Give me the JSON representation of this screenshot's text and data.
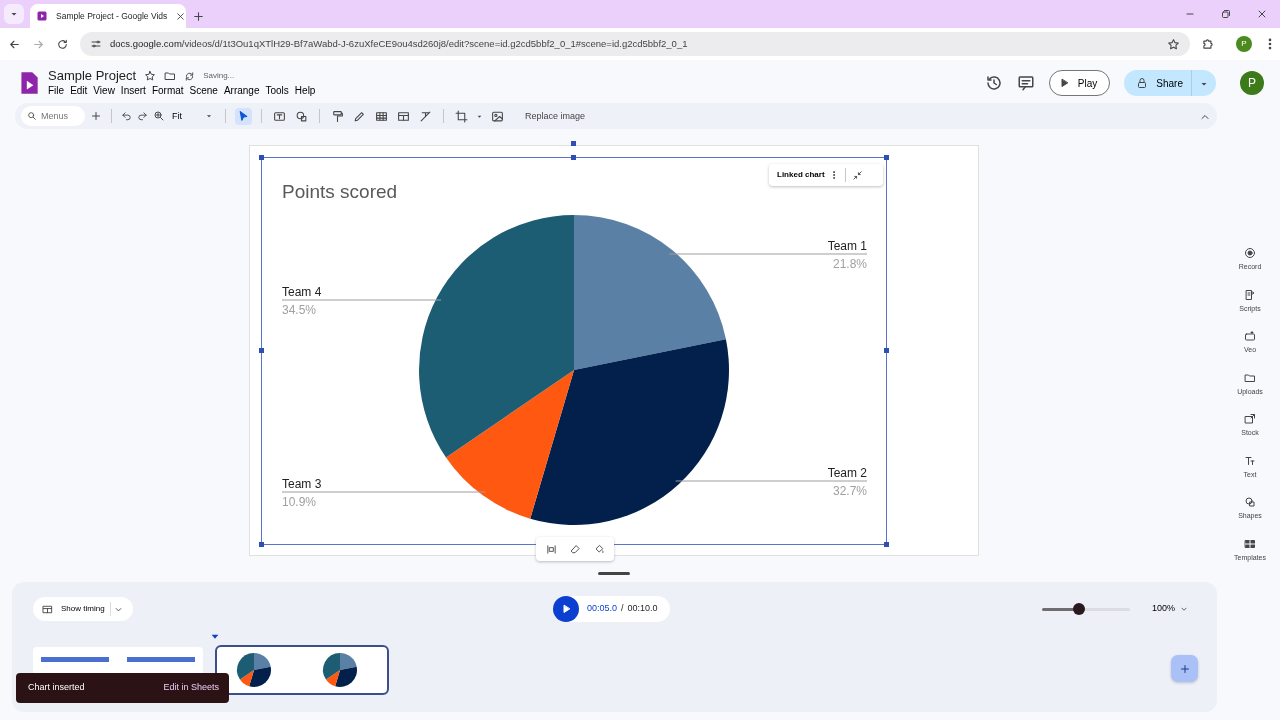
{
  "browser": {
    "tab_title": "Sample Project - Google Vids",
    "url": "docs.google.com/videos/d/1t3Ou1qXTlH29-Bf7aWabd-J-6zuXfeCE9ou4sd260j8/edit?scene=id.g2cd5bbf2_0_1#scene=id.g2cd5bbf2_0_1",
    "profile_initial": "P"
  },
  "app": {
    "title": "Sample Project",
    "save_status": "Saving...",
    "menus": [
      "File",
      "Edit",
      "View",
      "Insert",
      "Format",
      "Scene",
      "Arrange",
      "Tools",
      "Help"
    ],
    "play_label": "Play",
    "share_label": "Share",
    "avatar_initial": "P"
  },
  "toolbar": {
    "search_placeholder": "Menus",
    "zoom": "Fit",
    "replace_image": "Replace image",
    "tools": [
      {
        "selected": true
      },
      {
        "selected": false
      },
      {
        "selected": false
      },
      {
        "selected": false
      },
      {
        "selected": false
      },
      {
        "selected": false
      },
      {
        "selected": false
      },
      {
        "selected": false
      },
      {
        "selected": false
      },
      {
        "selected": false
      }
    ]
  },
  "slide": {
    "chart_toolbar_label": "Linked chart",
    "chart_data": {
      "type": "pie",
      "title": "Points scored",
      "categories": [
        "Team 1",
        "Team 2",
        "Team 3",
        "Team 4"
      ],
      "values": [
        21.8,
        32.7,
        10.9,
        34.5
      ],
      "colors": [
        "#5b80a5",
        "#02204b",
        "#ff5811",
        "#1d5d73"
      ],
      "data_labels": "value_labels",
      "value_labels": [
        "21.8%",
        "32.7%",
        "10.9%",
        "34.5%"
      ]
    }
  },
  "right_rail": [
    "Record",
    "Scripts",
    "Veo",
    "Uploads",
    "Stock",
    "Text",
    "Shapes",
    "Templates"
  ],
  "timeline": {
    "show_timing": "Show timing",
    "current_time": "00:05.0",
    "separator": "/",
    "total_time": "00:10.0",
    "zoom": {
      "level": 0.42
    },
    "zoom_label": "100%",
    "scenes": [
      {
        "kind": "bars",
        "selected": false
      },
      {
        "kind": "pie",
        "selected": true
      }
    ]
  },
  "snackbar": {
    "message": "Chart inserted",
    "action": "Edit in Sheets"
  }
}
